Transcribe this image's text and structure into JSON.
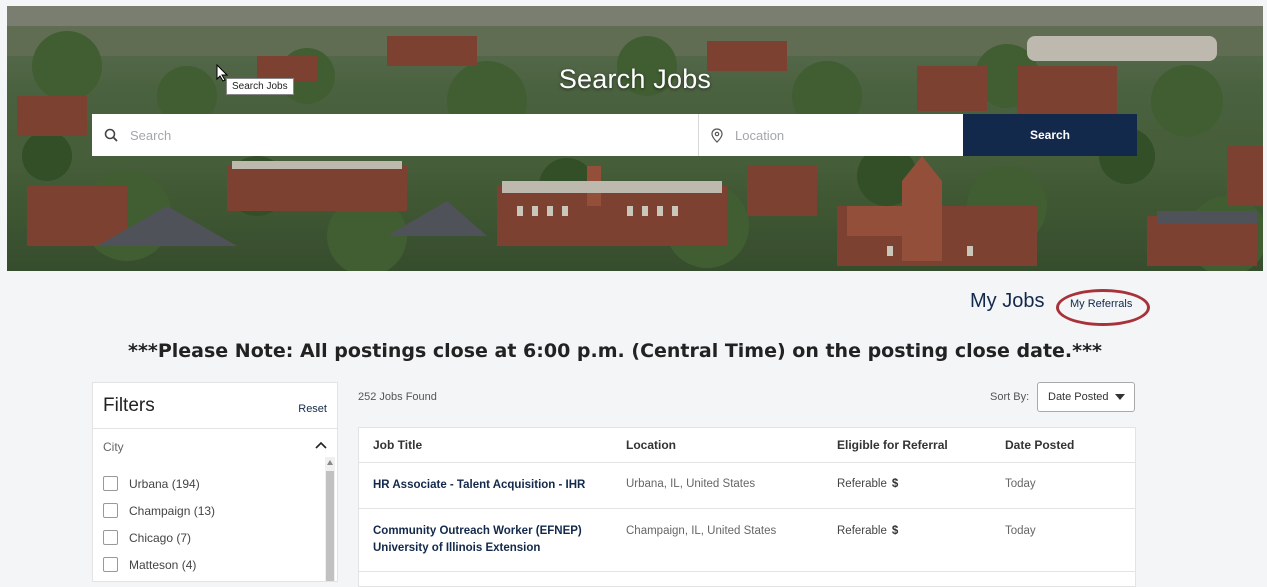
{
  "hero": {
    "title": "Search Jobs",
    "tooltip": "Search Jobs",
    "search_placeholder": "Search",
    "location_placeholder": "Location",
    "search_button": "Search"
  },
  "my_jobs": {
    "title": "My Jobs",
    "referrals_link": "My Referrals"
  },
  "notice": "***Please Note: All postings close at 6:00 p.m. (Central Time) on the posting close date.***",
  "filters": {
    "title": "Filters",
    "reset": "Reset",
    "city_label": "City",
    "cities": [
      {
        "label": "Urbana (194)"
      },
      {
        "label": "Champaign (13)"
      },
      {
        "label": "Chicago (7)"
      },
      {
        "label": "Matteson (4)"
      }
    ]
  },
  "results": {
    "count": "252 Jobs Found",
    "sort_label": "Sort By:",
    "sort_value": "Date Posted",
    "columns": [
      "Job Title",
      "Location",
      "Eligible for Referral",
      "Date Posted"
    ],
    "rows": [
      {
        "title_line1": "HR Associate - Talent Acquisition - IHR",
        "title_line2": "",
        "location": "Urbana, IL, United States",
        "referral": "Referable",
        "dollar": "$",
        "date": "Today"
      },
      {
        "title_line1": "Community Outreach Worker (EFNEP)",
        "title_line2": "University of Illinois Extension",
        "location": "Champaign, IL, United States",
        "referral": "Referable",
        "dollar": "$",
        "date": "Today"
      }
    ]
  },
  "colors": {
    "navy": "#13294b",
    "highlight": "#a8323a"
  }
}
